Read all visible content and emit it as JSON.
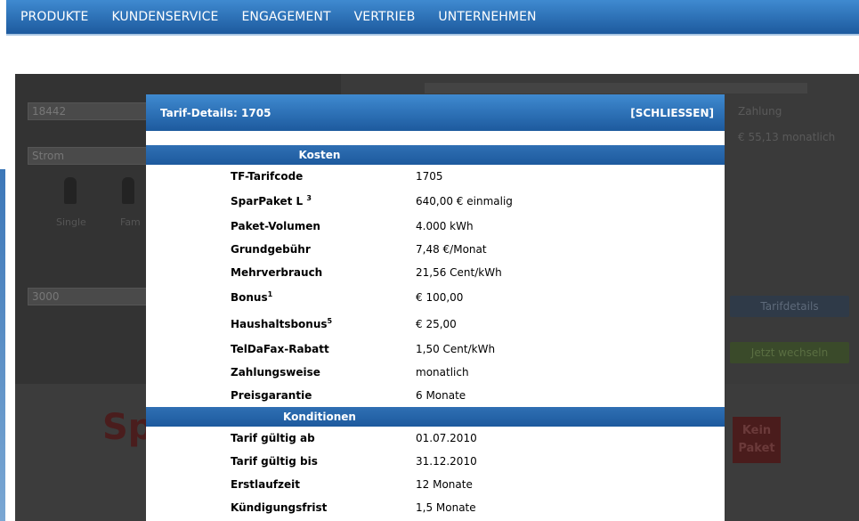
{
  "nav": {
    "items": [
      "PRODUKTE",
      "KUNDENSERVICE",
      "ENGAGEMENT",
      "VERTRIEB",
      "UNTERNEHMEN"
    ]
  },
  "background": {
    "postcode_value": "18442",
    "energy_select_value": "Strom",
    "person_labels": [
      "Single",
      "Fam"
    ],
    "consumption_value": "3000",
    "right_payment_label": "Zahlung",
    "right_price_text": "€ 55,13   monatlich",
    "bottom_word": "Sp",
    "kein_paket": "Kein Paket",
    "btn_details": "Tarifdetails",
    "btn_switch": "Jetzt wechseln"
  },
  "modal": {
    "title": "Tarif-Details: 1705",
    "close_label": "[SCHLIESSEN]",
    "sections": [
      {
        "heading": "Kosten",
        "rows": [
          {
            "label": "TF-Tarifcode",
            "sup": "",
            "value": "1705"
          },
          {
            "label": "SparPaket L ",
            "sup": "3",
            "value": "640,00 € einmalig"
          },
          {
            "label": "Paket-Volumen",
            "sup": "",
            "value": "4.000 kWh"
          },
          {
            "label": "Grundgebühr",
            "sup": "",
            "value": "7,48 €/Monat"
          },
          {
            "label": "Mehrverbrauch",
            "sup": "",
            "value": "21,56 Cent/kWh"
          },
          {
            "label": "Bonus",
            "sup": "1",
            "value": "€ 100,00"
          },
          {
            "label": "Haushaltsbonus",
            "sup": "5",
            "value": "€ 25,00"
          },
          {
            "label": "TelDaFax-Rabatt",
            "sup": "",
            "value": "1,50 Cent/kWh"
          },
          {
            "label": "Zahlungsweise",
            "sup": "",
            "value": "monatlich"
          },
          {
            "label": "Preisgarantie",
            "sup": "",
            "value": "6 Monate"
          }
        ]
      },
      {
        "heading": "Konditionen",
        "rows": [
          {
            "label": "Tarif gültig ab",
            "sup": "",
            "value": "01.07.2010"
          },
          {
            "label": "Tarif gültig bis",
            "sup": "",
            "value": "31.12.2010"
          },
          {
            "label": "Erstlaufzeit",
            "sup": "",
            "value": "12 Monate"
          },
          {
            "label": "Kündigungsfrist",
            "sup": "",
            "value": "1,5 Monate"
          }
        ]
      }
    ]
  }
}
